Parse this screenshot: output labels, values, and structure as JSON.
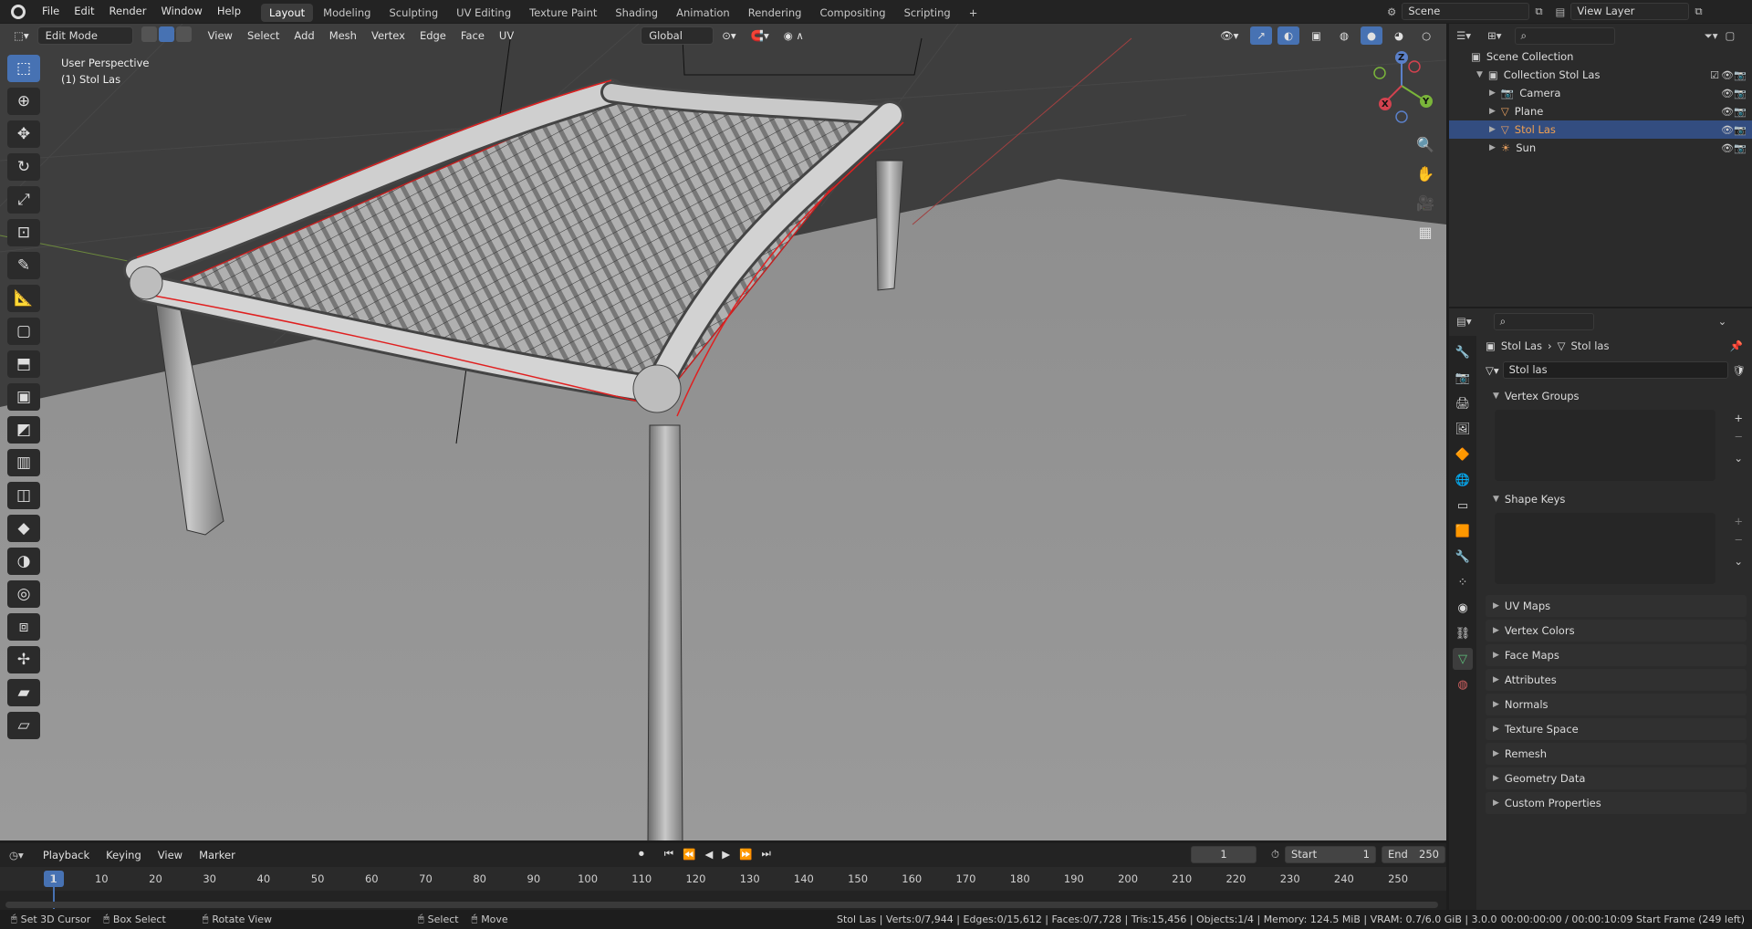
{
  "top_menu": [
    "File",
    "Edit",
    "Render",
    "Window",
    "Help"
  ],
  "workspaces": [
    "Layout",
    "Modeling",
    "Sculpting",
    "UV Editing",
    "Texture Paint",
    "Shading",
    "Animation",
    "Rendering",
    "Compositing",
    "Scripting"
  ],
  "active_workspace": "Layout",
  "add_workspace": "+",
  "scene_name": "Scene",
  "view_layer": "View Layer",
  "viewport": {
    "mode": "Edit Mode",
    "menus": [
      "View",
      "Select",
      "Add",
      "Mesh",
      "Vertex",
      "Edge",
      "Face",
      "UV"
    ],
    "orientation": "Global",
    "perspective_label": "User Perspective",
    "object_label": "(1) Stol Las",
    "gizmo_axes": {
      "x": "X",
      "y": "Y",
      "z": "Z"
    }
  },
  "outliner": {
    "root": "Scene Collection",
    "collection": "Collection Stol Las",
    "items": [
      {
        "label": "Camera",
        "icon": "camera-icon",
        "selected": false
      },
      {
        "label": "Plane",
        "icon": "mesh-icon",
        "selected": false
      },
      {
        "label": "Stol Las",
        "icon": "mesh-icon",
        "selected": true
      },
      {
        "label": "Sun",
        "icon": "light-icon",
        "selected": false
      }
    ]
  },
  "properties": {
    "breadcrumb_object": "Stol Las",
    "breadcrumb_data": "Stol las",
    "mesh_name": "Stol las",
    "panels_open": [
      "Vertex Groups",
      "Shape Keys"
    ],
    "panels_closed": [
      "UV Maps",
      "Vertex Colors",
      "Face Maps",
      "Attributes",
      "Normals",
      "Texture Space",
      "Remesh",
      "Geometry Data",
      "Custom Properties"
    ]
  },
  "timeline": {
    "menus": [
      "Playback",
      "Keying",
      "View",
      "Marker"
    ],
    "current_frame": "1",
    "start_label": "Start",
    "start": "1",
    "end_label": "End",
    "end": "250",
    "ticks": [
      "1",
      "10",
      "20",
      "30",
      "40",
      "50",
      "60",
      "70",
      "80",
      "90",
      "100",
      "110",
      "120",
      "130",
      "140",
      "150",
      "160",
      "170",
      "180",
      "190",
      "200",
      "210",
      "220",
      "230",
      "240",
      "250"
    ]
  },
  "statusbar": {
    "hints": [
      "Set 3D Cursor",
      "Box Select",
      "Rotate View",
      "Select",
      "Move"
    ],
    "stats": "Stol Las | Verts:0/7,944 | Edges:0/15,612 | Faces:0/7,728 | Tris:15,456 | Objects:1/4 | Memory: 124.5 MiB | VRAM: 0.7/6.0 GiB | 3.0.0",
    "time": "00:00:00:00 / 00:00:10:09 Start Frame (249 left)"
  },
  "colors": {
    "accent": "#4772b3",
    "selection": "#334d80",
    "edge_highlight": "#e02020"
  }
}
